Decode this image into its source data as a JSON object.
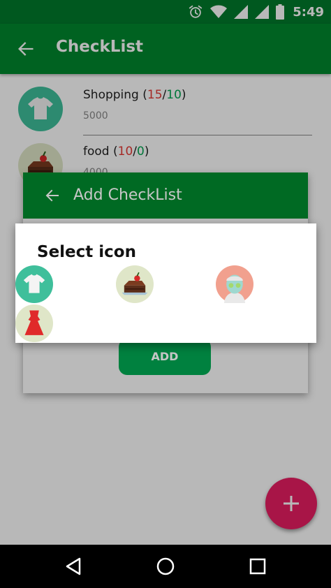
{
  "status_bar": {
    "time": "5:49",
    "icons": [
      "alarm-icon",
      "wifi-icon",
      "signal-icon",
      "signal-icon",
      "battery-icon"
    ]
  },
  "toolbar": {
    "title": "CheckList",
    "back_icon": "arrow-left-icon"
  },
  "list": {
    "items": [
      {
        "name": "Shopping",
        "done": "15",
        "total": "10",
        "amount": "5000",
        "icon": "tshirt-icon"
      },
      {
        "name": "food",
        "done": "10",
        "total": "0",
        "amount": "4000",
        "icon": "cake-icon"
      }
    ]
  },
  "add_dialog": {
    "title": "Add CheckList",
    "add_label": "ADD"
  },
  "select_dialog": {
    "title": "Select icon",
    "icons": [
      "tshirt-icon",
      "cake-icon",
      "face-mask-icon",
      "dress-icon"
    ]
  },
  "fab": {
    "icon": "plus-icon"
  },
  "colors": {
    "primary": "#00882e",
    "primary_dark": "#007a2c",
    "accent": "#e91e63",
    "red": "#e53935",
    "green": "#00a651"
  },
  "nav": {
    "icons": [
      "back-triangle-icon",
      "home-circle-icon",
      "recents-square-icon"
    ]
  }
}
